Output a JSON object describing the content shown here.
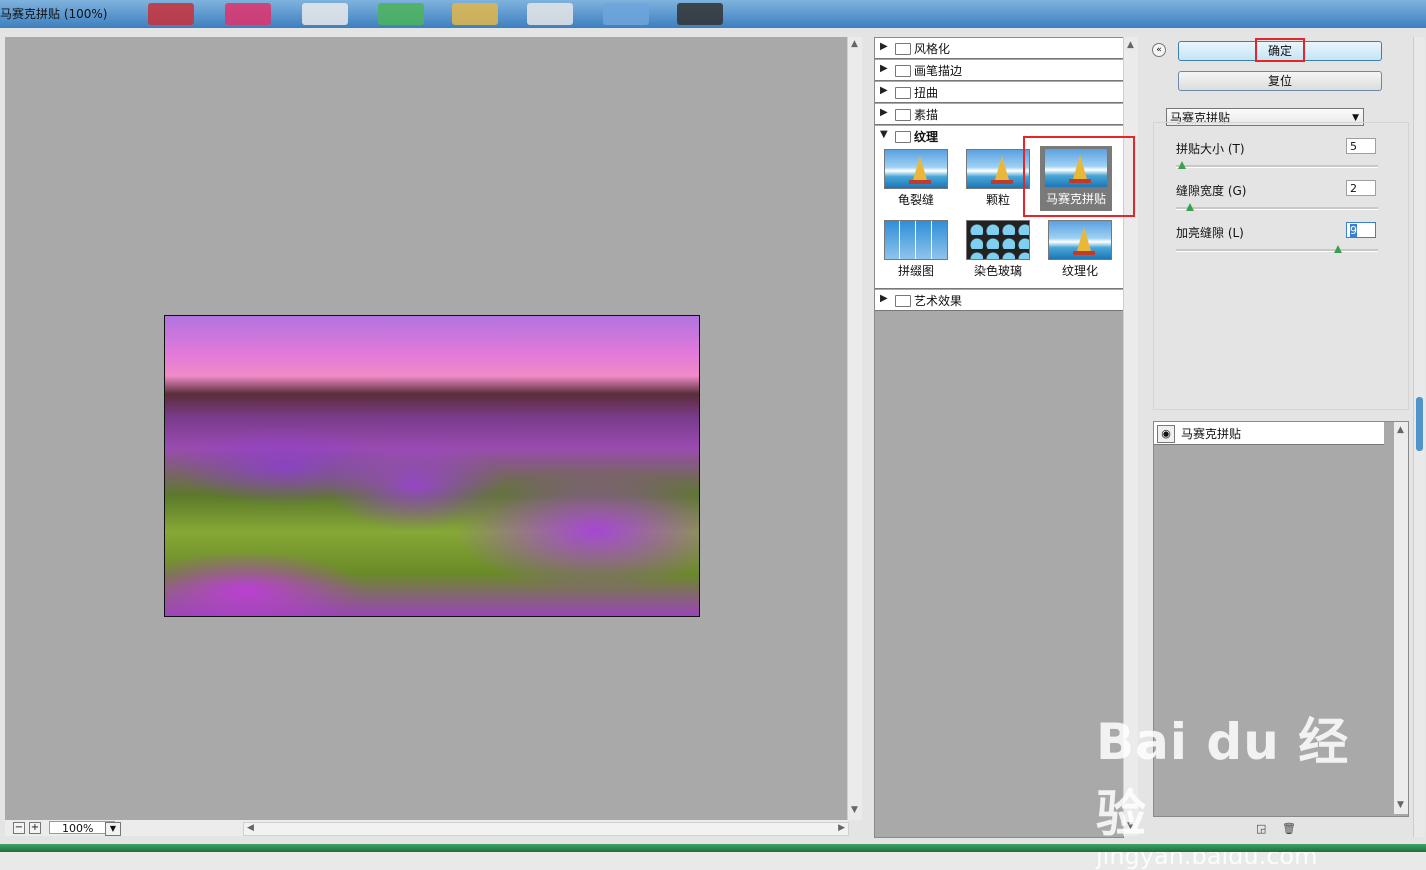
{
  "window": {
    "title": "马赛克拼贴 (100%)"
  },
  "preview": {
    "zoom": "100%",
    "zoom_out": "−",
    "zoom_in": "+"
  },
  "gallery": {
    "categories": [
      {
        "label": "风格化",
        "expanded": false
      },
      {
        "label": "画笔描边",
        "expanded": false
      },
      {
        "label": "扭曲",
        "expanded": false
      },
      {
        "label": "素描",
        "expanded": false
      },
      {
        "label": "纹理",
        "expanded": true
      },
      {
        "label": "艺术效果",
        "expanded": false
      }
    ],
    "texture_filters": [
      "龟裂缝",
      "颗粒",
      "马赛克拼贴",
      "拼缀图",
      "染色玻璃",
      "纹理化"
    ],
    "selected": "马赛克拼贴"
  },
  "panel": {
    "ok_label": "确定",
    "reset_label": "复位",
    "filter_select": "马赛克拼贴",
    "params": [
      {
        "label": "拼贴大小 (T)",
        "value": "5",
        "slider_fraction": 0.03
      },
      {
        "label": "缝隙宽度 (G)",
        "value": "2",
        "slider_fraction": 0.07
      },
      {
        "label": "加亮缝隙 (L)",
        "value": "9",
        "slider_fraction": 0.8
      }
    ],
    "layer_name": "马赛克拼贴"
  },
  "watermark": {
    "logo": "Bai du 经验",
    "url": "jingyan.baidu.com"
  },
  "colors": {
    "highlight_box": "#e5252a",
    "ok_button": "#c4e5f6",
    "preview_bg": "#a9a9a9"
  }
}
